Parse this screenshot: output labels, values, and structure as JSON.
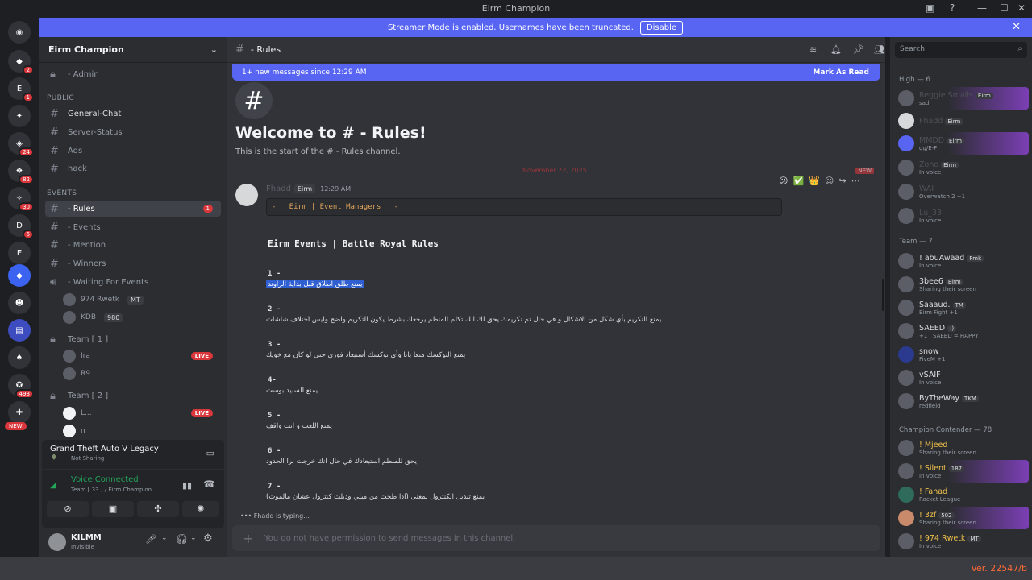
{
  "window": {
    "title": "Eirm Champion"
  },
  "banner": {
    "text": "Streamer Mode is enabled. Usernames have been truncated.",
    "disable_label": "Disable"
  },
  "guild_badges": [
    "2",
    "1",
    "24",
    "82",
    "30",
    "6",
    "493"
  ],
  "guild_new_label": "NEW",
  "server": {
    "name": "Eirm Champion"
  },
  "channels": {
    "admin": "- Admin",
    "public_cat": "PUBLIC",
    "general": "General-Chat",
    "server_status": "Server-Status",
    "ads": "Ads",
    "hack": "hack",
    "events_cat": "EVENTS",
    "rules": "- Rules",
    "rules_unread": "1",
    "events": "- Events",
    "mention": "- Mention",
    "winners": "- Winners",
    "waiting": "- Waiting For Events",
    "voice_user1": "974 Rwetk",
    "voice_user1_tag": "MT",
    "voice_user2": "KDB",
    "voice_user2_tag": "980",
    "team1": "Team [ 1 ]",
    "team1_u1": "Ira",
    "team1_u2": "R9",
    "team2": "Team [ 2 ]",
    "team2_u1": "L...",
    "team2_u2": "n",
    "live": "LIVE"
  },
  "activity": {
    "game": "Grand Theft Auto V Legacy",
    "status": "Not Sharing"
  },
  "voice": {
    "status": "Voice Connected",
    "channel": "Team [ 33 ] / Eirm Champion"
  },
  "user": {
    "name": "KILMM",
    "status": "Invisible"
  },
  "chat": {
    "channel": "- Rules",
    "new_messages": "1+ new messages since 12:29 AM",
    "mark_read": "Mark As Read",
    "welcome_title": "Welcome to # - Rules!",
    "welcome_sub": "This is the start of the # - Rules channel.",
    "date": "November 22, 2025",
    "new_label": "NEW",
    "author": "Fhadd",
    "author_tag": "Eirm",
    "time": "12:29 AM",
    "code": "-   Eirm | Event Managers   -",
    "heading": "Eirm Events | Battle Royal Rules",
    "rules": [
      {
        "num": "1 -",
        "text": "يمنع طلق اطلاق قبل بداية الراوند"
      },
      {
        "num": "2 -",
        "text": "يمنع التكريم بأي شكل من الاشكال و في حال تم تكريمك يحق لك انك تكلم المنظم يرجعك بشرط يكون التكريم واضح وليس اختلاف شاشات"
      },
      {
        "num": "3 -",
        "text": "يمنع التوكسك منعا باتا وأي توكسك أستبعاد فوري حتى لو كان مع خويك"
      },
      {
        "num": "4-",
        "text": "يمنع السبيد بوست"
      },
      {
        "num": "5 -",
        "text": "يمنع اللعب و انت واقف"
      },
      {
        "num": "6 -",
        "text": "يحق للمنظم استبعادك في حال انك خرجت برا الحدود"
      },
      {
        "num": "7 -",
        "text": "يمنع تبديل الكنترول بمعنى (اذا طحت من ميلي ودبلت كنترول عشان مالموت)"
      }
    ],
    "typing": "Fhadd is typing...",
    "composer": "You do not have permission to send messages in this channel."
  },
  "members": {
    "search_placeholder": "Search",
    "high": "High — 6",
    "team": "Team — 7",
    "contender": "Champion Contender — 78",
    "list_high": [
      {
        "name": "Reggie Smalls",
        "tag": "Eirm",
        "status": "sad"
      },
      {
        "name": "Fhadd",
        "tag": "Eirm",
        "status": ""
      },
      {
        "name": "MMDD",
        "tag": "Eirm",
        "status": "gg/E-F"
      },
      {
        "name": "Zono",
        "tag": "Eirm",
        "status": "In voice"
      },
      {
        "name": "WAI",
        "tag": "",
        "status": "Overwatch 2 +1"
      },
      {
        "name": "Lu_33",
        "tag": "",
        "status": "In voice"
      }
    ],
    "list_team": [
      {
        "name": "! abuAwaad",
        "tag": "Fmk",
        "status": "In voice"
      },
      {
        "name": "3bee6",
        "tag": "Eirm",
        "status": "Sharing their screen"
      },
      {
        "name": "Saaaud.",
        "tag": "TM",
        "status": "Eirm Fight +1"
      },
      {
        "name": "SAEED",
        "tag": ":)",
        "status": "+1 · SAEED = HAPPY"
      },
      {
        "name": "snow",
        "tag": "",
        "status": "FiveM +1"
      },
      {
        "name": "vSAIF",
        "tag": "",
        "status": "In voice"
      },
      {
        "name": "ByTheWay",
        "tag": "TKM",
        "status": "redfield"
      }
    ],
    "list_contender": [
      {
        "name": "! Mjeed",
        "tag": "",
        "status": "Sharing their screen"
      },
      {
        "name": "! Silent",
        "tag": "187",
        "status": "In voice"
      },
      {
        "name": "! Fahad",
        "tag": "",
        "status": "Rocket League"
      },
      {
        "name": "! 3zf",
        "tag": "502",
        "status": "Sharing their screen"
      },
      {
        "name": "! 974 Rwetk",
        "tag": "MT",
        "status": "In voice"
      }
    ]
  },
  "version": "Ver. 22547/b"
}
